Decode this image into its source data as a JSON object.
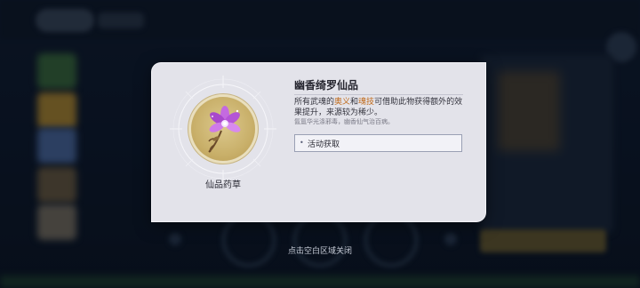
{
  "item": {
    "title": "幽香绮罗仙品",
    "category": "仙品药草",
    "description_parts": [
      "所有武魂的",
      "奥义",
      "和",
      "魂技",
      "可借助此物获得额外的效果提升，来源较为稀少。"
    ],
    "flavor": "氤氲华光涤邪毒，幽香仙气治百病。",
    "source": "活动获取"
  },
  "close_hint": "点击空白区域关闭",
  "colors": {
    "card_bg": "#e3e3ea",
    "highlight": "#c06a1a",
    "medallion": "#c9b06a",
    "flower": "#b45ad2"
  },
  "icons": {
    "item_image": "purple-flower-icon",
    "source_bullet": "bullet-dot-icon"
  }
}
